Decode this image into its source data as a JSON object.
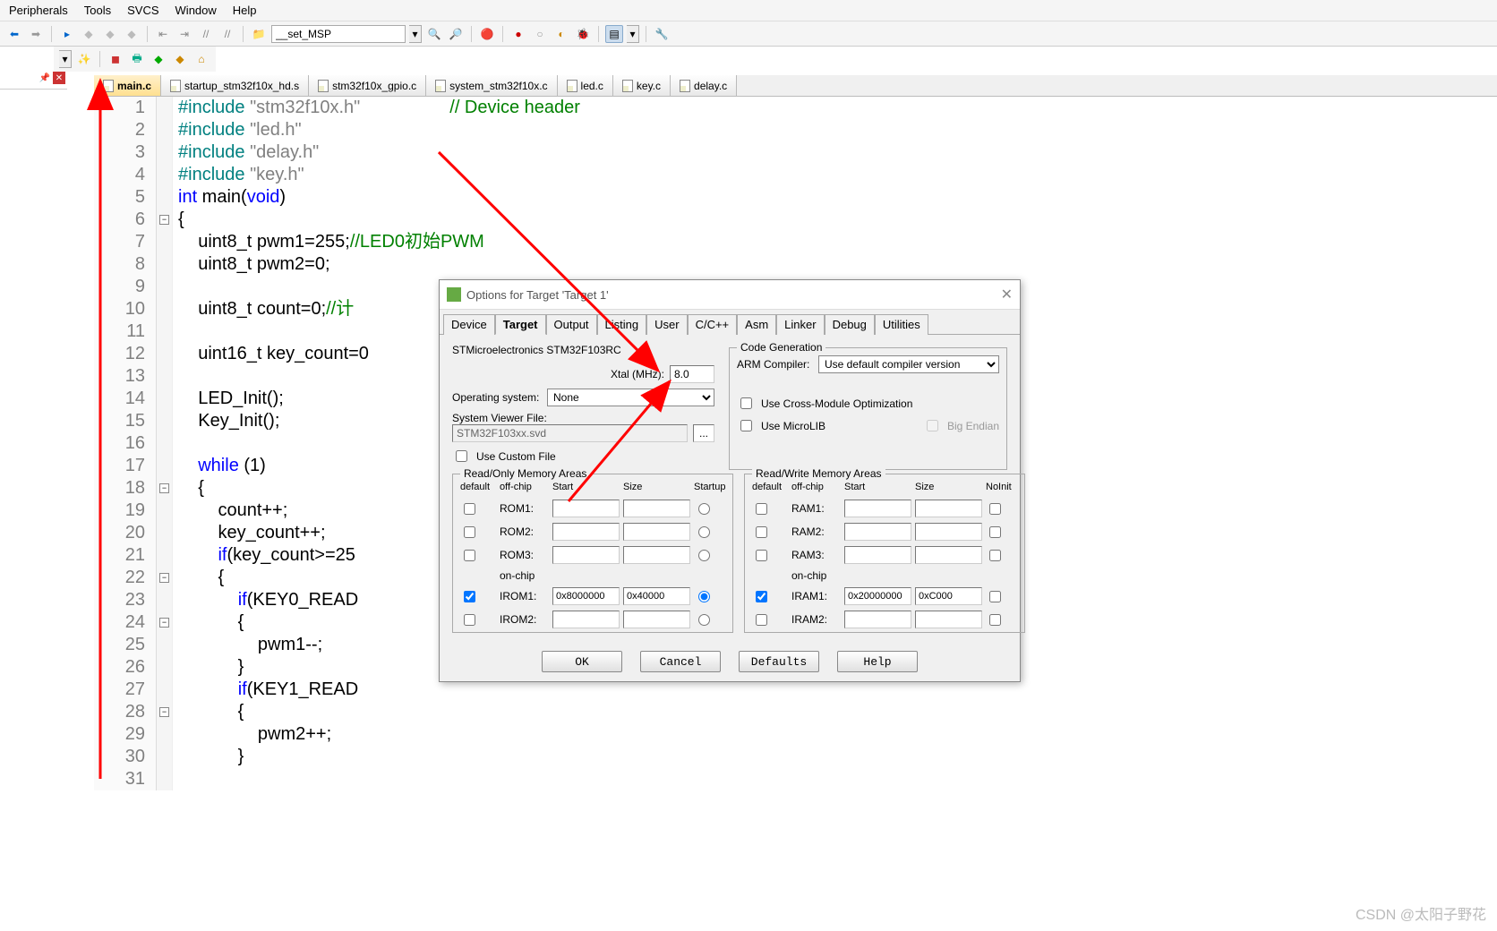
{
  "menu": {
    "items": [
      "Peripherals",
      "Tools",
      "SVCS",
      "Window",
      "Help"
    ]
  },
  "toolbar": {
    "combo_value": "__set_MSP"
  },
  "tabs": [
    {
      "label": "main.c",
      "active": true
    },
    {
      "label": "startup_stm32f10x_hd.s"
    },
    {
      "label": "stm32f10x_gpio.c"
    },
    {
      "label": "system_stm32f10x.c"
    },
    {
      "label": "led.c"
    },
    {
      "label": "key.c"
    },
    {
      "label": "delay.c"
    }
  ],
  "code": {
    "lines": [
      {
        "n": 1,
        "html": "<span class='pp'>#include</span> <span class='str'>\"stm32f10x.h\"</span>                  <span class='cm'>// Device header</span>"
      },
      {
        "n": 2,
        "html": "<span class='pp'>#include</span> <span class='str'>\"led.h\"</span>"
      },
      {
        "n": 3,
        "html": "<span class='pp'>#include</span> <span class='str'>\"delay.h\"</span>"
      },
      {
        "n": 4,
        "html": "<span class='pp'>#include</span> <span class='str'>\"key.h\"</span>"
      },
      {
        "n": 5,
        "html": "<span class='kw'>int</span> main(<span class='kw'>void</span>)"
      },
      {
        "n": 6,
        "html": "{",
        "fold": "-"
      },
      {
        "n": 7,
        "html": "    uint8_t pwm1=<span class='num'>255</span>;<span class='cm'>//LED0初始PWM</span>"
      },
      {
        "n": 8,
        "html": "    uint8_t pwm2=<span class='num'>0</span>;"
      },
      {
        "n": 9,
        "html": ""
      },
      {
        "n": 10,
        "html": "    uint8_t count=<span class='num'>0</span>;<span class='cm'>//计</span>"
      },
      {
        "n": 11,
        "html": ""
      },
      {
        "n": 12,
        "html": "    uint16_t key_count=0"
      },
      {
        "n": 13,
        "html": ""
      },
      {
        "n": 14,
        "html": "    LED_Init();"
      },
      {
        "n": 15,
        "html": "    Key_Init();"
      },
      {
        "n": 16,
        "html": ""
      },
      {
        "n": 17,
        "html": "    <span class='kw'>while</span> (<span class='num'>1</span>)"
      },
      {
        "n": 18,
        "html": "    {",
        "fold": "-"
      },
      {
        "n": 19,
        "html": "        count++;"
      },
      {
        "n": 20,
        "html": "        key_count++;"
      },
      {
        "n": 21,
        "html": "        <span class='kw'>if</span>(key_count>=<span class='num'>25</span>"
      },
      {
        "n": 22,
        "html": "        {",
        "fold": "-"
      },
      {
        "n": 23,
        "html": "            <span class='kw'>if</span>(KEY0_READ"
      },
      {
        "n": 24,
        "html": "            {",
        "fold": "-"
      },
      {
        "n": 25,
        "html": "                pwm1--;"
      },
      {
        "n": 26,
        "html": "            }"
      },
      {
        "n": 27,
        "html": "            <span class='kw'>if</span>(KEY1_READ"
      },
      {
        "n": 28,
        "html": "            {",
        "fold": "-"
      },
      {
        "n": 29,
        "html": "                pwm2++;"
      },
      {
        "n": 30,
        "html": "            }"
      },
      {
        "n": 31,
        "html": ""
      }
    ]
  },
  "dialog": {
    "title": "Options for Target 'Target 1'",
    "tabs": [
      "Device",
      "Target",
      "Output",
      "Listing",
      "User",
      "C/C++",
      "Asm",
      "Linker",
      "Debug",
      "Utilities"
    ],
    "active_tab": "Target",
    "device": "STMicroelectronics STM32F103RC",
    "xtal_label": "Xtal (MHz):",
    "xtal": "8.0",
    "os_label": "Operating system:",
    "os": "None",
    "svf_label": "System Viewer File:",
    "svf": "STM32F103xx.svd",
    "use_custom": "Use Custom File",
    "codegen": {
      "title": "Code Generation",
      "compiler_label": "ARM Compiler:",
      "compiler": "Use default compiler version",
      "cross": "Use Cross-Module Optimization",
      "microlib": "Use MicroLIB",
      "bigendian": "Big Endian"
    },
    "rom": {
      "title": "Read/Only Memory Areas",
      "hdr": [
        "default",
        "off-chip",
        "Start",
        "Size",
        "Startup"
      ],
      "rows": [
        {
          "label": "ROM1:",
          "chk": false,
          "start": "",
          "size": "",
          "radio": false
        },
        {
          "label": "ROM2:",
          "chk": false,
          "start": "",
          "size": "",
          "radio": false
        },
        {
          "label": "ROM3:",
          "chk": false,
          "start": "",
          "size": "",
          "radio": false
        }
      ],
      "onchip": "on-chip",
      "orows": [
        {
          "label": "IROM1:",
          "chk": true,
          "start": "0x8000000",
          "size": "0x40000",
          "radio": true
        },
        {
          "label": "IROM2:",
          "chk": false,
          "start": "",
          "size": "",
          "radio": false
        }
      ]
    },
    "ram": {
      "title": "Read/Write Memory Areas",
      "hdr": [
        "default",
        "off-chip",
        "Start",
        "Size",
        "NoInit"
      ],
      "rows": [
        {
          "label": "RAM1:",
          "chk": false,
          "start": "",
          "size": "",
          "ni": false
        },
        {
          "label": "RAM2:",
          "chk": false,
          "start": "",
          "size": "",
          "ni": false
        },
        {
          "label": "RAM3:",
          "chk": false,
          "start": "",
          "size": "",
          "ni": false
        }
      ],
      "onchip": "on-chip",
      "orows": [
        {
          "label": "IRAM1:",
          "chk": true,
          "start": "0x20000000",
          "size": "0xC000",
          "ni": false
        },
        {
          "label": "IRAM2:",
          "chk": false,
          "start": "",
          "size": "",
          "ni": false
        }
      ]
    },
    "buttons": {
      "ok": "OK",
      "cancel": "Cancel",
      "defaults": "Defaults",
      "help": "Help"
    }
  },
  "watermark": "CSDN @太阳子野花"
}
